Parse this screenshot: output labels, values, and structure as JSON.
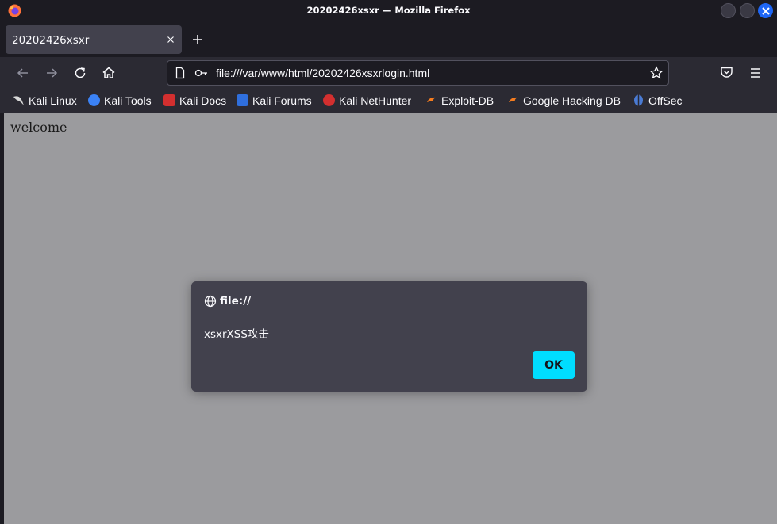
{
  "window": {
    "title": "20202426xsxr — Mozilla Firefox"
  },
  "tabs": [
    {
      "label": "20202426xsxr"
    }
  ],
  "urlbar": {
    "url": "file:///var/www/html/20202426xsxrlogin.html"
  },
  "bookmarks": [
    {
      "label": "Kali Linux",
      "icon": "kali-dragon-icon",
      "color": "#1b1b1b"
    },
    {
      "label": "Kali Tools",
      "icon": "kali-tools-icon",
      "color": "#3b82f6"
    },
    {
      "label": "Kali Docs",
      "icon": "kali-docs-icon",
      "color": "#d32f2f"
    },
    {
      "label": "Kali Forums",
      "icon": "kali-forums-icon",
      "color": "#2f6fde"
    },
    {
      "label": "Kali NetHunter",
      "icon": "kali-nethunter-icon",
      "color": "#d32f2f"
    },
    {
      "label": "Exploit-DB",
      "icon": "exploit-db-icon",
      "color": "#f57c1f"
    },
    {
      "label": "Google Hacking DB",
      "icon": "ghdb-icon",
      "color": "#f57c1f"
    },
    {
      "label": "OffSec",
      "icon": "offsec-icon",
      "color": "#4a7bd4"
    }
  ],
  "page": {
    "text": "welcome"
  },
  "dialog": {
    "origin": "file://",
    "message": "xsxrXSS攻击",
    "ok_label": "OK"
  },
  "colors": {
    "accent": "#00ddff",
    "toolbar": "#2b2a33",
    "titlebar": "#1c1b22",
    "overlay": "#9b9b9e"
  }
}
